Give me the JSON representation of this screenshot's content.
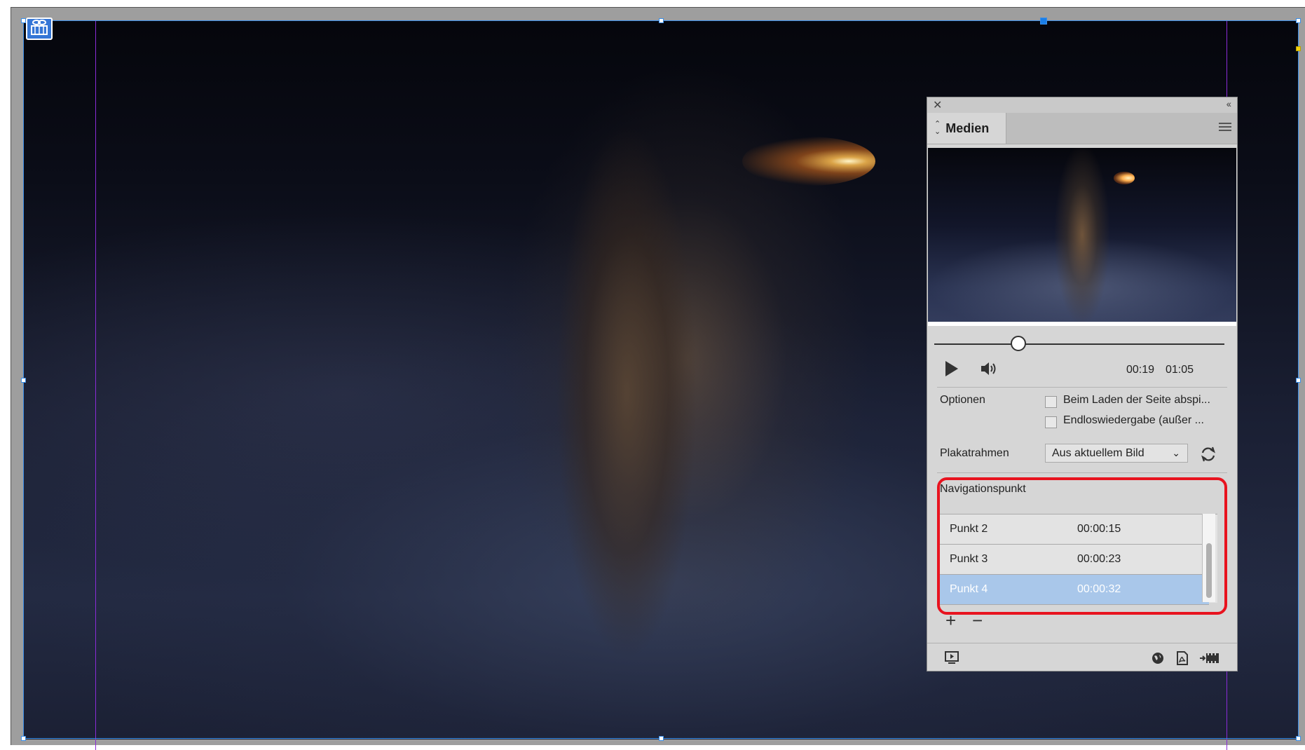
{
  "panel": {
    "title": "Medien",
    "playback": {
      "current_time": "00:19",
      "duration": "01:05",
      "position_fraction": 0.29
    },
    "options": {
      "label": "Optionen",
      "checkbox_1": "Beim Laden der Seite abspi...",
      "checkbox_2": "Endloswiedergabe (außer ..."
    },
    "poster": {
      "label": "Plakatrahmen",
      "selected": "Aus aktuellem Bild"
    },
    "navigation": {
      "label": "Navigationspunkt",
      "points": [
        {
          "name": "Punkt 2",
          "time": "00:00:15"
        },
        {
          "name": "Punkt 3",
          "time": "00:00:23"
        },
        {
          "name": "Punkt 4",
          "time": "00:00:32"
        }
      ],
      "selected_index": 2
    }
  },
  "icons": {
    "close": "close-icon",
    "collapse": "collapse-icon",
    "menu": "panel-menu-icon",
    "play": "play-icon",
    "volume": "volume-icon",
    "refresh": "refresh-icon",
    "add": "plus-icon",
    "remove": "minus-icon",
    "preview": "preview-icon",
    "web": "globe-icon",
    "pdf": "pdf-icon",
    "video": "video-icon"
  },
  "colors": {
    "highlight_border": "#e8131f",
    "selection": "#a9c7ea",
    "frame_selection": "#3b8ee8",
    "guides": "#8a2bd8"
  }
}
